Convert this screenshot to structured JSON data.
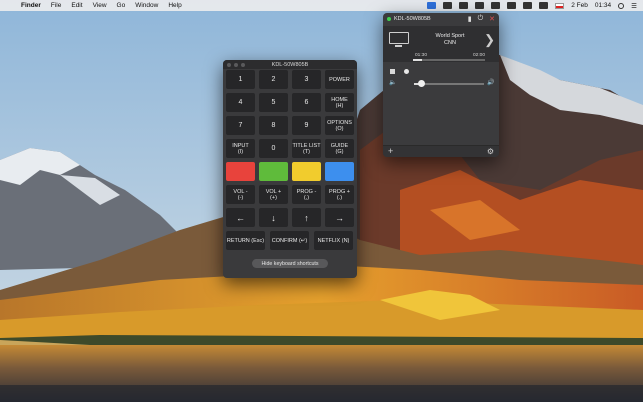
{
  "menubar": {
    "apple": "",
    "items": [
      "Finder",
      "File",
      "Edit",
      "View",
      "Go",
      "Window",
      "Help"
    ],
    "date": "2 Feb",
    "time": "01:34"
  },
  "remote": {
    "title": "KDL-50W805B",
    "keys": {
      "k1": "1",
      "k2": "2",
      "k3": "3",
      "power": "POWER",
      "k4": "4",
      "k5": "5",
      "k6": "6",
      "home": "HOME\n(H)",
      "k7": "7",
      "k8": "8",
      "k9": "9",
      "options": "OPTIONS\n(O)",
      "input": "INPUT\n(I)",
      "k0": "0",
      "title_list": "TITLE LIST\n(T)",
      "guide": "GUIDE\n(G)",
      "vol_minus": "VOL -\n(-)",
      "vol_plus": "VOL +\n(+)",
      "prog_minus": "PROG -\n(,)",
      "prog_plus": "PROG +\n(.)",
      "left": "←",
      "down": "↓",
      "up": "↑",
      "right": "→",
      "return": "RETURN (Esc)",
      "confirm": "CONFIRM (↵)",
      "netflix": "NETFLIX (N)"
    },
    "colors": {
      "red": "#e8433c",
      "green": "#5fbb3b",
      "yellow": "#f1cc2d",
      "blue": "#3d8fee"
    },
    "hide_label": "Hide keyboard shortcuts"
  },
  "popup": {
    "device": "KDL-50W805B",
    "status_color": "#3fcf4f",
    "channel": "World Sport",
    "network": "CNN",
    "start_time": "01:30",
    "end_time": "02:00",
    "progress": 0.12,
    "volume": 0.1,
    "icons": {
      "remote": "remote-icon",
      "power": "power-icon",
      "close": "close-icon",
      "next": "chevron-right-icon",
      "stop": "stop-icon",
      "record": "record-icon",
      "mute": "speaker-muted-icon",
      "vol_up": "speaker-icon",
      "add": "plus-icon",
      "settings": "gear-icon"
    },
    "glyphs": {
      "power": "⏻",
      "close": "✕",
      "next": "❯",
      "mute": "🔈",
      "vol_up": "🔊",
      "add": "+",
      "settings": "⚙"
    }
  }
}
